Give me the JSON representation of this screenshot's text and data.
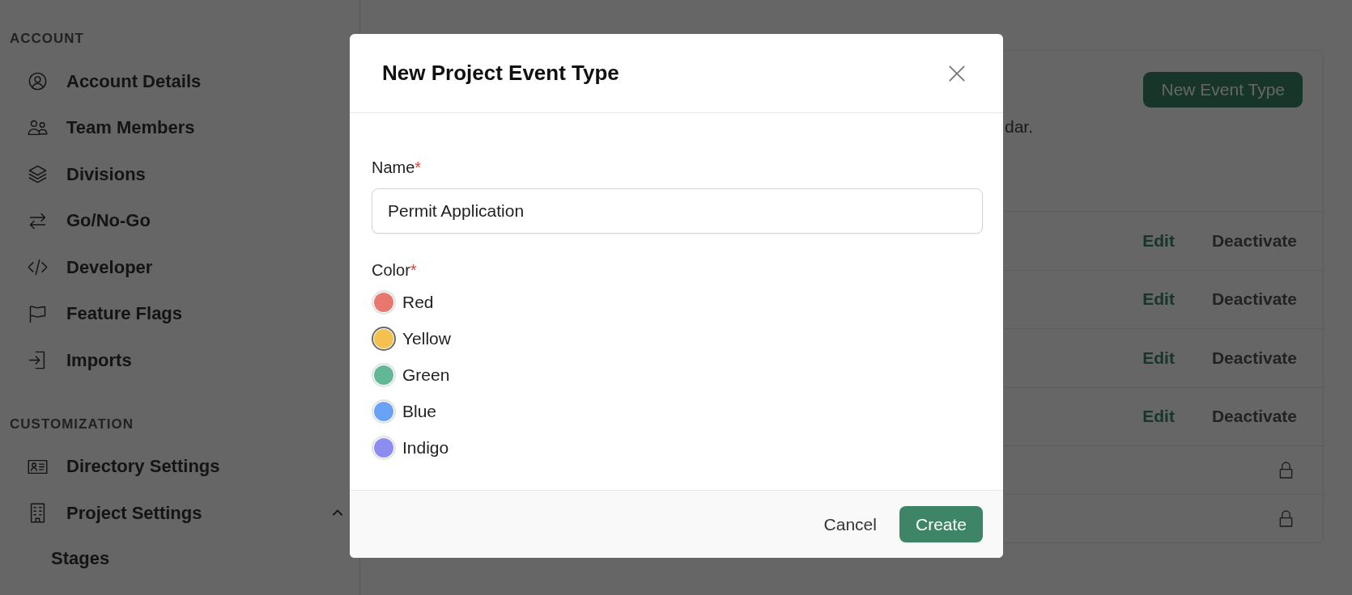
{
  "sidebar": {
    "sections": [
      {
        "title": "ACCOUNT",
        "items": [
          {
            "label": "Account Details"
          },
          {
            "label": "Team Members"
          },
          {
            "label": "Divisions"
          },
          {
            "label": "Go/No-Go"
          },
          {
            "label": "Developer"
          },
          {
            "label": "Feature Flags"
          },
          {
            "label": "Imports"
          }
        ]
      },
      {
        "title": "CUSTOMIZATION",
        "items": [
          {
            "label": "Directory Settings"
          },
          {
            "label": "Project Settings",
            "expanded": true,
            "children": [
              {
                "label": "Stages"
              }
            ]
          }
        ]
      }
    ]
  },
  "main": {
    "new_button": "New Event Type",
    "description": "dar.",
    "rows": [
      {
        "kind": "editable",
        "edit": "Edit",
        "deactivate": "Deactivate"
      },
      {
        "kind": "editable",
        "edit": "Edit",
        "deactivate": "Deactivate"
      },
      {
        "kind": "editable",
        "edit": "Edit",
        "deactivate": "Deactivate"
      },
      {
        "kind": "editable",
        "edit": "Edit",
        "deactivate": "Deactivate"
      },
      {
        "kind": "locked"
      },
      {
        "kind": "locked"
      }
    ]
  },
  "modal": {
    "title": "New Project Event Type",
    "name_field": {
      "label": "Name",
      "required_mark": "*",
      "value": "Permit Application"
    },
    "color_field": {
      "label": "Color",
      "required_mark": "*",
      "options": [
        {
          "label": "Red",
          "color": "#e8776f",
          "selected": false
        },
        {
          "label": "Yellow",
          "color": "#f2c14e",
          "selected": true
        },
        {
          "label": "Green",
          "color": "#62b896",
          "selected": false
        },
        {
          "label": "Blue",
          "color": "#6aa3f5",
          "selected": false
        },
        {
          "label": "Indigo",
          "color": "#8b8ef0",
          "selected": false
        }
      ]
    },
    "cancel": "Cancel",
    "create": "Create"
  }
}
